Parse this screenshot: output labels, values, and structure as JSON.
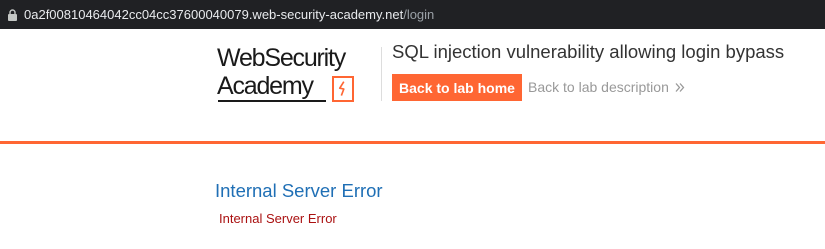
{
  "browser": {
    "url_host": "0a2f00810464042cc04cc37600040079.web-security-academy.net",
    "url_path": "/login",
    "lock_icon": "lock-icon"
  },
  "lab_header": {
    "logo_line1": "WebSecurity",
    "logo_line2": "Academy",
    "title": "SQL injection vulnerability allowing login bypass",
    "back_home_label": "Back to lab home",
    "back_description_label": "Back to lab description",
    "back_description_icon": "double-chevron-right-icon",
    "accent_color": "#ff6633"
  },
  "content": {
    "error_heading": "Internal Server Error",
    "error_message": "Internal Server Error",
    "heading_color": "#1f6fb5",
    "message_color": "#aa1111"
  }
}
